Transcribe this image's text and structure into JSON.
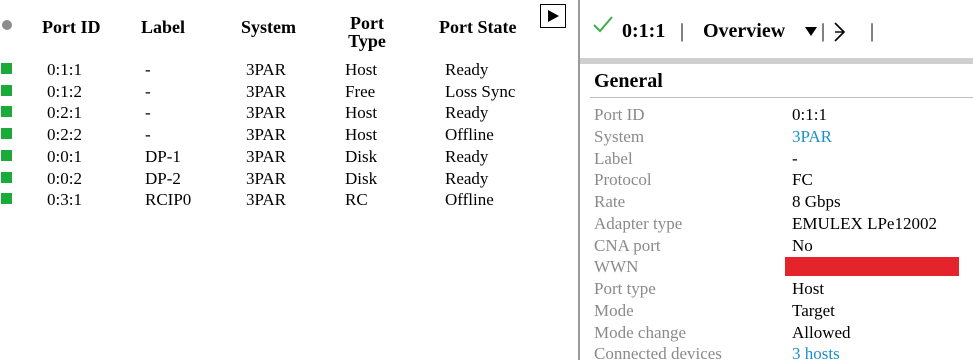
{
  "table": {
    "columns": {
      "port_id": "Port ID",
      "label": "Label",
      "system": "System",
      "port_type": [
        "Port",
        "Type"
      ],
      "port_state": "Port State"
    },
    "status_color": "#1bab3b",
    "rows": [
      {
        "port_id": "0:1:1",
        "label": "-",
        "system": "3PAR",
        "port_type": "Host",
        "port_state": "Ready"
      },
      {
        "port_id": "0:1:2",
        "label": "-",
        "system": "3PAR",
        "port_type": "Free",
        "port_state": "Loss Sync"
      },
      {
        "port_id": "0:2:1",
        "label": "-",
        "system": "3PAR",
        "port_type": "Host",
        "port_state": "Ready"
      },
      {
        "port_id": "0:2:2",
        "label": "-",
        "system": "3PAR",
        "port_type": "Host",
        "port_state": "Offline"
      },
      {
        "port_id": "0:0:1",
        "label": "DP-1",
        "system": "3PAR",
        "port_type": "Disk",
        "port_state": "Ready"
      },
      {
        "port_id": "0:0:2",
        "label": "DP-2",
        "system": "3PAR",
        "port_type": "Disk",
        "port_state": "Ready"
      },
      {
        "port_id": "0:3:1",
        "label": "RCIP0",
        "system": "3PAR",
        "port_type": "RC",
        "port_state": "Offline"
      }
    ]
  },
  "icons": {
    "status": "status-dot-icon",
    "play": "play-icon",
    "ok": "checkmark-icon",
    "caret": "chevron-down-icon",
    "tree": "topology-icon",
    "ok_color": "#3fae49",
    "link_color": "#1e8fc7",
    "redaction_color": "#e3242b"
  },
  "panel": {
    "title": "0:1:1",
    "separator": "|",
    "view": "Overview",
    "section": "General",
    "properties": [
      {
        "label": "Port ID",
        "value": "0:1:1"
      },
      {
        "label": "System",
        "value": "3PAR",
        "link": true
      },
      {
        "label": "Label",
        "value": "-"
      },
      {
        "label": "Protocol",
        "value": "FC"
      },
      {
        "label": "Rate",
        "value": "8 Gbps"
      },
      {
        "label": "Adapter type",
        "value": "EMULEX LPe12002"
      },
      {
        "label": "CNA port",
        "value": "No"
      },
      {
        "label": "WWN",
        "value": null,
        "redacted": true
      },
      {
        "label": "Port type",
        "value": "Host"
      },
      {
        "label": "Mode",
        "value": "Target"
      },
      {
        "label": "Mode change",
        "value": "Allowed"
      },
      {
        "label": "Connected devices",
        "value": "3 hosts",
        "link": true
      }
    ]
  }
}
